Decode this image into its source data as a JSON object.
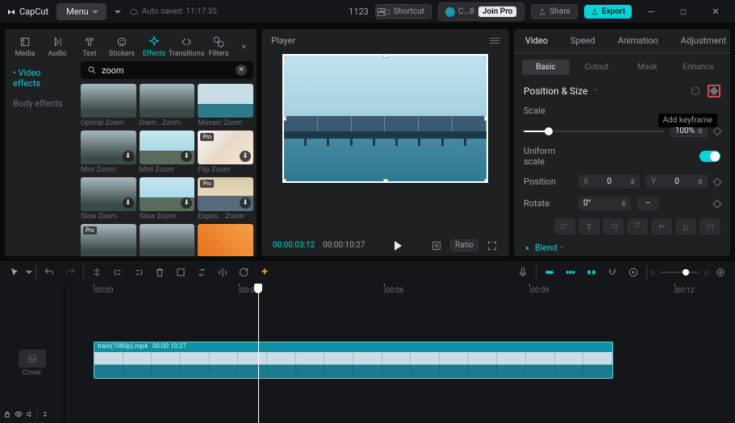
{
  "app": {
    "name": "CapCut",
    "menu": "Menu",
    "autosave": "Auto saved: 11:17:35",
    "project": "1123"
  },
  "title_btns": {
    "shortcut": "Shortcut",
    "user": "C...8",
    "join": "Join Pro",
    "share": "Share",
    "export": "Export"
  },
  "left_tabs": [
    "Media",
    "Audio",
    "Text",
    "Stickers",
    "Effects",
    "Transitions",
    "Filters"
  ],
  "left_active_index": 4,
  "sub_nav": [
    "Video effects",
    "Body effects"
  ],
  "sub_active_index": 0,
  "search": {
    "placeholder": "",
    "value": "zoom"
  },
  "thumbs": [
    {
      "label": "Optical Zoom",
      "cls": "forest1",
      "pro": false,
      "dl": false
    },
    {
      "label": "Diam...Zoom",
      "cls": "forest1",
      "pro": false,
      "dl": false
    },
    {
      "label": "Mosaic Zoom",
      "cls": "sky",
      "pro": false,
      "dl": false
    },
    {
      "label": "Mini Zoom",
      "cls": "forest1",
      "pro": false,
      "dl": true
    },
    {
      "label": "Mini Zoom",
      "cls": "forest2",
      "pro": false,
      "dl": true
    },
    {
      "label": "Flip Zoom",
      "cls": "swirl",
      "pro": true,
      "dl": true
    },
    {
      "label": "Slow Zoom",
      "cls": "forest1",
      "pro": false,
      "dl": true
    },
    {
      "label": "Slow Zoom",
      "cls": "forest2",
      "pro": false,
      "dl": true
    },
    {
      "label": "Expos... Zoom",
      "cls": "city",
      "pro": true,
      "dl": true
    },
    {
      "label": "",
      "cls": "forest1",
      "pro": true,
      "dl": false
    },
    {
      "label": "",
      "cls": "forest1",
      "pro": false,
      "dl": false
    },
    {
      "label": "",
      "cls": "orange",
      "pro": false,
      "dl": false
    }
  ],
  "player": {
    "title": "Player",
    "current": "00:00:03:12",
    "duration": "00:00:10:27",
    "ratio_label": "Ratio"
  },
  "right_tabs": [
    "Video",
    "Speed",
    "Animation",
    "Adjustment"
  ],
  "right_active_index": 0,
  "sub_tabs": [
    "Basic",
    "Cutout",
    "Mask",
    "Enhance"
  ],
  "sub_tab_active": 0,
  "position_size": {
    "title": "Position & Size",
    "scale_label": "Scale",
    "scale_pct": "100%",
    "scale_val": 40,
    "uniform_label": "Uniform scale",
    "uniform": true,
    "position_label": "Position",
    "x_label": "X",
    "x": "0",
    "y_label": "Y",
    "y": "0",
    "rotate_label": "Rotate",
    "rotate": "0°",
    "keyframe_tooltip": "Add keyframe"
  },
  "blend_title": "Blend",
  "ruler_ticks": [
    "|00:00",
    "|00:03",
    "|00:06",
    "|00:09",
    "|00:12"
  ],
  "clip": {
    "name": "train(1080p).mp4",
    "dur": "00:00:10:27"
  },
  "cover_label": "Cover"
}
